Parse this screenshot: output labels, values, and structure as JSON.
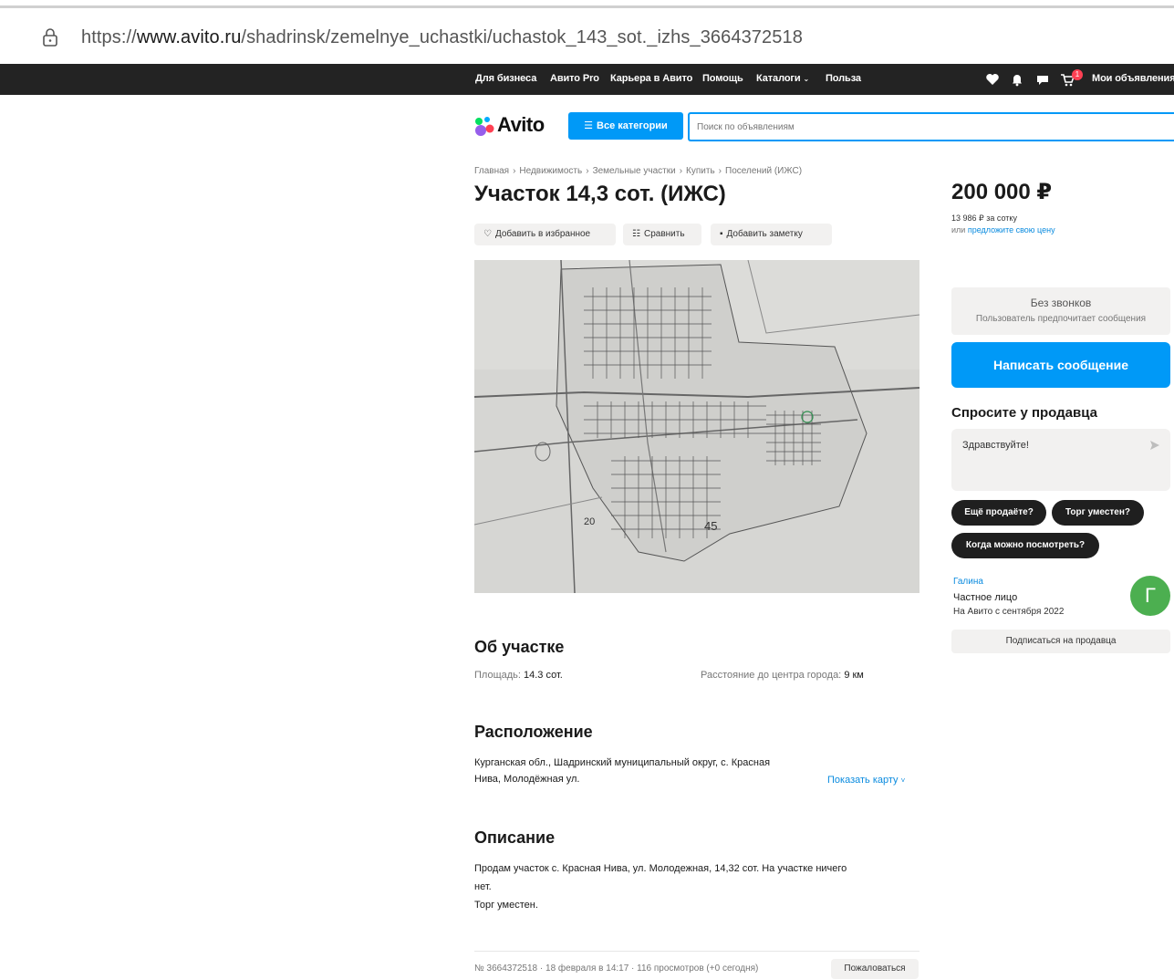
{
  "browser": {
    "url_prefix": "https://",
    "url_host": "www.avito.ru",
    "url_path": "/shadrinsk/zemelnye_uchastki/uchastok_143_sot._izhs_3664372518",
    "lock_icon": "lock-icon"
  },
  "topnav": {
    "links": [
      "Для бизнеса",
      "Авито Pro",
      "Карьера в Авито",
      "Помощь",
      "Каталоги",
      "Польза"
    ],
    "my_ads": "Мои объявления",
    "cart_badge": "1",
    "icons": [
      "heart-icon",
      "bell-icon",
      "chat-icon",
      "cart-icon"
    ]
  },
  "header": {
    "logo_text": "Avito",
    "all_categories": "Все категории",
    "search_placeholder": "Поиск по объявлениям"
  },
  "listing": {
    "breadcrumbs": [
      "Главная",
      "Недвижимость",
      "Земельные участки",
      "Купить",
      "Поселений (ИЖС)"
    ],
    "title": "Участок 14,3 сот. (ИЖС)",
    "actions": {
      "favorite": "Добавить в избранное",
      "compare": "Сравнить",
      "note": "Добавить заметку"
    },
    "photo_labels": [
      "20",
      "45"
    ],
    "about": {
      "heading": "Об участке",
      "area_label": "Площадь:",
      "area_value": "14.3 сот.",
      "distance_label": "Расстояние до центра города:",
      "distance_value": "9 км"
    },
    "location": {
      "heading": "Расположение",
      "address_line1": "Курганская обл., Шадринский муниципальный округ, с. Красная",
      "address_line2": "Нива, Молодёжная ул.",
      "show_map": "Показать карту"
    },
    "description": {
      "heading": "Описание",
      "line1": "Продам участок с. Красная Нива, ул. Молодежная, 14,32 сот. На участке ничего",
      "line2": "нет.",
      "line3": "Торг уместен."
    },
    "footer": {
      "meta": "№ 3664372518 · 18 февраля в 14:17 · 116 просмотров (+0 сегодня)",
      "report": "Пожаловаться"
    }
  },
  "sidebar": {
    "price": "200 000 ₽",
    "price_per": "13 986 ₽ за сотку",
    "price_offer_prefix": "или",
    "price_offer_link": "предложите свою цену",
    "no_calls_title": "Без звонков",
    "no_calls_sub": "Пользователь предпочитает сообщения",
    "write_button": "Написать сообщение",
    "ask_heading": "Спросите у продавца",
    "ask_text": "Здравствуйте!",
    "chips": [
      "Ещё продаёте?",
      "Торг уместен?",
      "Когда можно посмотреть?"
    ],
    "seller": {
      "name": "Галина",
      "type": "Частное лицо",
      "since": "На Авито с сентября 2022",
      "avatar_letter": "Г",
      "subscribe": "Подписаться на продавца"
    }
  },
  "colors": {
    "accent": "#0099f7",
    "link": "#0a8bdf",
    "nav_bg": "#232323",
    "avatar_bg": "#4caf50"
  }
}
